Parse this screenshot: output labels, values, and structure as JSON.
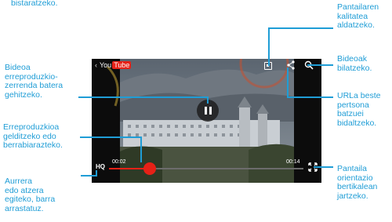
{
  "top_caption": "bistaratzeko.",
  "labels": {
    "quality": "Pantailaren\nkalitatea\naldatzeko.",
    "search": "Bideoak\nbilatzeko.",
    "share": "URLa beste\npertsona\nbatzuei\nbidaltzeko.",
    "rotate": "Pantaila\norientazio\nbertikalean\njartzeko.",
    "playlist": "Bideoa\nerreproduzkio-\nzerrenda batera\ngehitzeko.",
    "pause": "Erreproduzkioa\ngelditzeko edo\nberrabiarazteko.",
    "seek": "Aurrera\nedo atzera\negiteko, barra\narrastatuz."
  },
  "player": {
    "logo_you": "You",
    "logo_tube": "Tube",
    "time_elapsed": "00:02",
    "time_total": "00:14",
    "hq": "HQ",
    "progress": 0.21
  },
  "colors": {
    "accent": "#1f9dd6",
    "youtube_red": "#e62117"
  }
}
